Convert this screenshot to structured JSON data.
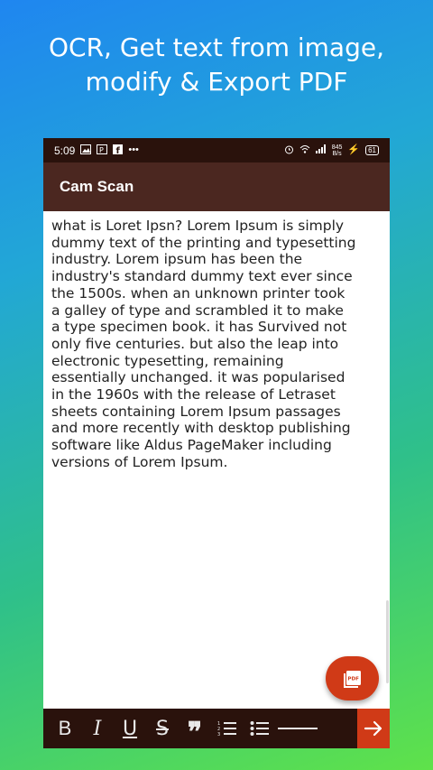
{
  "promo": {
    "line1": "OCR, Get text from image,",
    "line2": "modify & Export PDF"
  },
  "status_bar": {
    "time": "5:09",
    "notification_icons": [
      "gallery-icon",
      "p-notification-icon",
      "facebook-icon",
      "more-dots-icon"
    ],
    "net_speed_value": "845",
    "net_speed_unit": "B/s",
    "battery": "61"
  },
  "app_bar": {
    "title": "Cam Scan"
  },
  "editor": {
    "content": "what is Loret Ipsn? Lorem Ipsum is simply\ndummy text of the printing and typesetting\nindustry. Lorem ipsum has been the\nindustry's standard dummy text ever since\nthe 1500s. when an unknown printer took\na galley of type and scrambled it to make\na type specimen book. it has Survived not\nonly five centuries. but also the leap into\nelectronic typesetting, remaining\nessentially unchanged. it was popularised\nin the 1960s with the release of Letraset\nsheets containing Lorem Ipsum passages\nand more recently with desktop publishing\nsoftware like Aldus PageMaker including\nversions of Lorem Ipsum."
  },
  "fab": {
    "label": "PDF"
  },
  "toolbar": {
    "bold": "B",
    "italic": "I",
    "underline": "U",
    "strike": "S",
    "quote": "❞",
    "accent_color": "#d03a17"
  },
  "colors": {
    "status_bar": "#2a120c",
    "app_bar": "#4b2720",
    "accent": "#d03a17"
  }
}
